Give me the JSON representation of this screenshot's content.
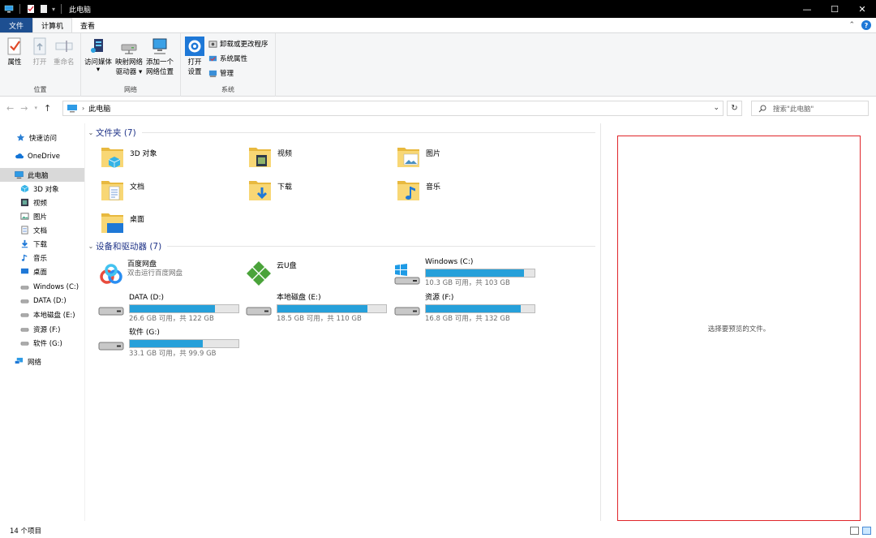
{
  "window": {
    "title": "此电脑",
    "minimize": "—",
    "maximize": "☐",
    "close": "✕"
  },
  "ribbon_tabs": [
    {
      "label": "文件"
    },
    {
      "label": "计算机"
    },
    {
      "label": "查看"
    }
  ],
  "ribbon": {
    "location_group": {
      "label": "位置",
      "properties": "属性",
      "open": "打开",
      "rename": "重命名"
    },
    "network_group": {
      "label": "网络",
      "access_media_1": "访问媒体",
      "map_drive_1": "映射网络",
      "map_drive_2": "驱动器 ▾",
      "add_location_1": "添加一个",
      "add_location_2": "网络位置"
    },
    "system_group": {
      "label": "系统",
      "open_settings_1": "打开",
      "open_settings_2": "设置",
      "uninstall": "卸载或更改程序",
      "system_props": "系统属性",
      "manage": "管理"
    }
  },
  "address": {
    "path": "此电脑",
    "search_placeholder": "搜索\"此电脑\""
  },
  "sidebar": {
    "items": [
      {
        "label": "快速访问",
        "icon": "star-icon"
      },
      {
        "label": "OneDrive",
        "icon": "cloud-icon"
      },
      {
        "label": "此电脑",
        "icon": "pc-icon",
        "selected": true
      },
      {
        "label": "3D 对象",
        "icon": "cube-icon"
      },
      {
        "label": "视频",
        "icon": "video-icon"
      },
      {
        "label": "图片",
        "icon": "picture-icon"
      },
      {
        "label": "文档",
        "icon": "document-icon"
      },
      {
        "label": "下载",
        "icon": "download-icon"
      },
      {
        "label": "音乐",
        "icon": "music-icon"
      },
      {
        "label": "桌面",
        "icon": "desktop-icon"
      },
      {
        "label": "Windows (C:)",
        "icon": "drive-icon"
      },
      {
        "label": "DATA (D:)",
        "icon": "drive-icon"
      },
      {
        "label": "本地磁盘 (E:)",
        "icon": "drive-icon"
      },
      {
        "label": "资源 (F:)",
        "icon": "drive-icon"
      },
      {
        "label": "软件 (G:)",
        "icon": "drive-icon"
      },
      {
        "label": "网络",
        "icon": "network-icon"
      }
    ]
  },
  "folders_group": {
    "title": "文件夹 (7)",
    "items": [
      {
        "name": "3D 对象"
      },
      {
        "name": "视频"
      },
      {
        "name": "图片"
      },
      {
        "name": "文档"
      },
      {
        "name": "下载"
      },
      {
        "name": "音乐"
      },
      {
        "name": "桌面"
      }
    ]
  },
  "devices_group": {
    "title": "设备和驱动器 (7)",
    "baidu": {
      "name": "百度网盘",
      "sub": "双击运行百度网盘"
    },
    "yunu": {
      "name": "云U盘"
    },
    "drives": [
      {
        "name": "Windows (C:)",
        "free": "10.3 GB 可用，共 103 GB",
        "used_fraction": 0.9
      },
      {
        "name": "DATA (D:)",
        "free": "26.6 GB 可用，共 122 GB",
        "used_fraction": 0.78
      },
      {
        "name": "本地磁盘 (E:)",
        "free": "18.5 GB 可用，共 110 GB",
        "used_fraction": 0.83
      },
      {
        "name": "资源 (F:)",
        "free": "16.8 GB 可用，共 132 GB",
        "used_fraction": 0.87
      },
      {
        "name": "软件 (G:)",
        "free": "33.1 GB 可用，共 99.9 GB",
        "used_fraction": 0.67
      }
    ]
  },
  "preview": {
    "text": "选择要预览的文件。"
  },
  "status": {
    "count": "14 个项目"
  },
  "colors": {
    "accent": "#1d4f91",
    "drive_bar": "#26a0da",
    "group_title": "#1e3287",
    "preview_border": "#e0252a"
  }
}
